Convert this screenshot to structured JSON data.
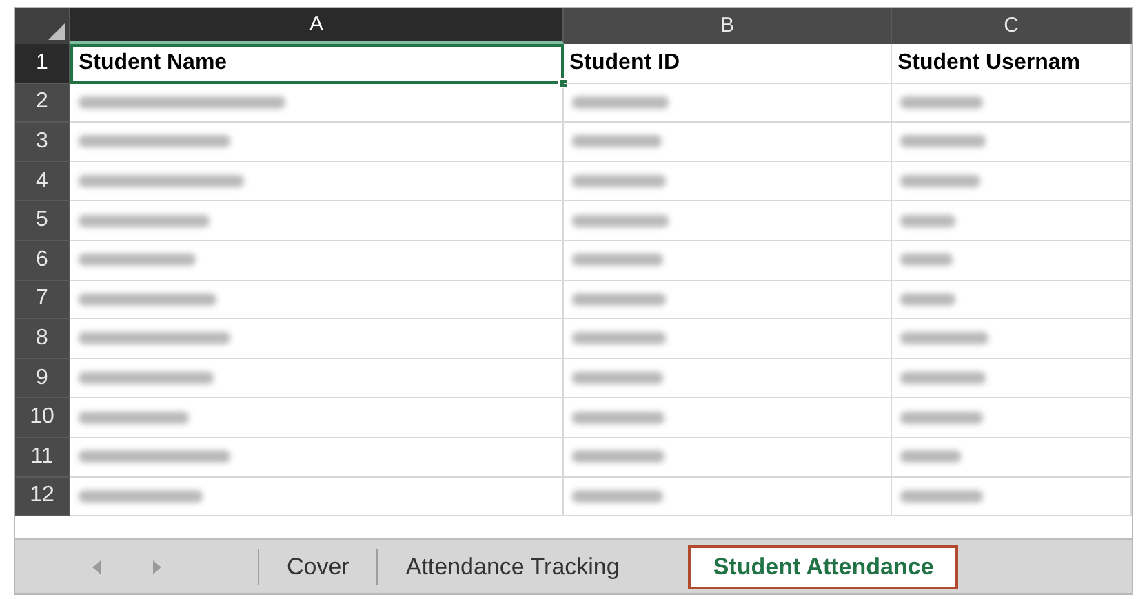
{
  "columns": [
    {
      "label": "A",
      "selected": true
    },
    {
      "label": "B",
      "selected": false
    },
    {
      "label": "C",
      "selected": false
    }
  ],
  "rows": [
    {
      "number": "1",
      "selected": true,
      "cells": [
        {
          "text": "Student Name",
          "active": true
        },
        {
          "text": "Student ID",
          "active": false
        },
        {
          "text": "Student Usernam",
          "active": false
        }
      ]
    },
    {
      "number": "2",
      "selected": false,
      "kind": "blurred"
    },
    {
      "number": "3",
      "selected": false,
      "kind": "blurred"
    },
    {
      "number": "4",
      "selected": false,
      "kind": "blurred"
    },
    {
      "number": "5",
      "selected": false,
      "kind": "blurred"
    },
    {
      "number": "6",
      "selected": false,
      "kind": "blurred"
    },
    {
      "number": "7",
      "selected": false,
      "kind": "blurred"
    },
    {
      "number": "8",
      "selected": false,
      "kind": "blurred"
    },
    {
      "number": "9",
      "selected": false,
      "kind": "blurred"
    },
    {
      "number": "10",
      "selected": false,
      "kind": "blurred"
    },
    {
      "number": "11",
      "selected": false,
      "kind": "blurred"
    },
    {
      "number": "12",
      "selected": false,
      "kind": "blurred"
    }
  ],
  "sheet_tabs": [
    {
      "label": "Cover",
      "selected": false
    },
    {
      "label": "Attendance Tracking",
      "selected": false
    },
    {
      "label": "Student Attendance",
      "selected": true
    }
  ]
}
